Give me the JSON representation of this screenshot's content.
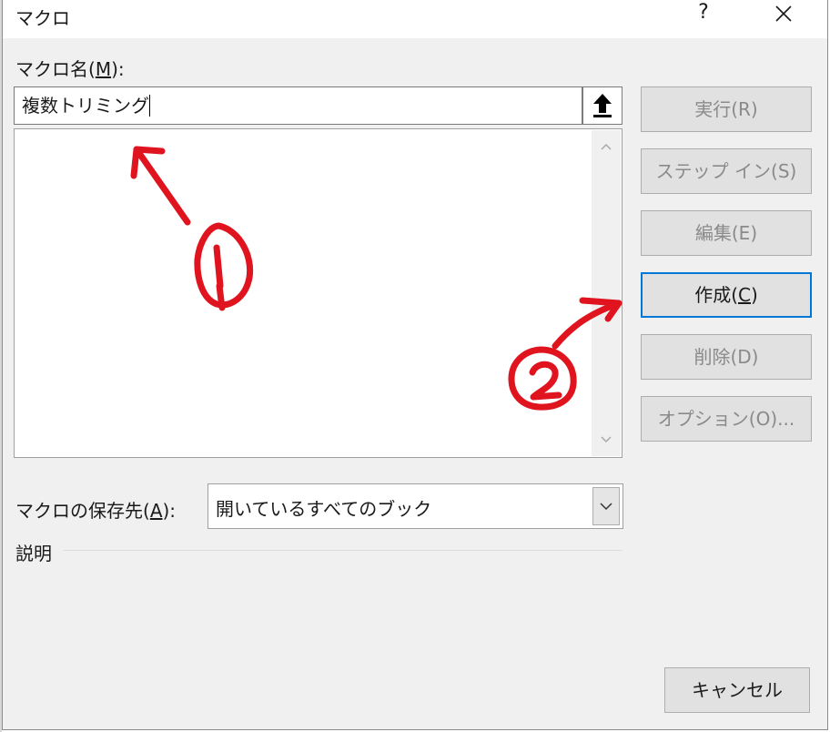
{
  "window": {
    "title": "マクロ",
    "help_label": "?",
    "close_label": "✕"
  },
  "macro_name": {
    "label_pre": "マクロ名(",
    "label_key": "M",
    "label_post": "):",
    "value": "複数トリミング"
  },
  "macro_list": {
    "items": []
  },
  "buttons": {
    "run": "実行(R)",
    "step_in": "ステップ イン(S)",
    "edit": "編集(E)",
    "create_pre": "作成(",
    "create_key": "C",
    "create_post": ")",
    "delete": "削除(D)",
    "options": "オプション(O)...",
    "cancel": "キャンセル"
  },
  "store_in": {
    "label_pre": "マクロの保存先(",
    "label_key": "A",
    "label_post": "):",
    "selected": "開いているすべてのブック"
  },
  "description": {
    "label": "説明",
    "value": ""
  },
  "annotations": {
    "color": "#e0141e",
    "marks": [
      "circled-1",
      "circled-2"
    ]
  },
  "icons": {
    "up_arrow": "up-arrow-icon",
    "dropdown": "chevron-down-icon"
  }
}
